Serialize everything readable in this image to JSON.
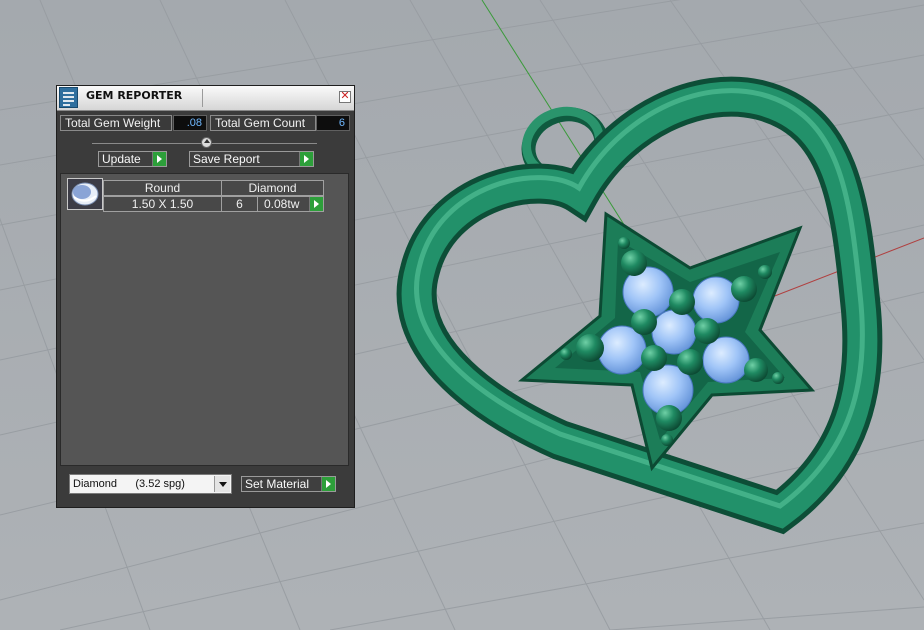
{
  "panel": {
    "title": "GEM REPORTER",
    "close_glyph": "✕",
    "app_icon": "gem-report-icon",
    "total_weight_label": "Total Gem Weight",
    "total_weight_value": ".08",
    "total_count_label": "Total Gem Count",
    "total_count_value": "6",
    "update_label": "Update",
    "save_report_label": "Save Report",
    "gem_list": {
      "columns": [
        "Round",
        "Diamond"
      ],
      "rows": [
        {
          "size": "1.50 X 1.50",
          "count": "6",
          "weight": "0.08tw",
          "thumb_icon": "round-gem-icon"
        }
      ]
    },
    "material_select_value": "Diamond      (3.52 spg)",
    "set_material_label": "Set Material"
  },
  "viewport": {
    "model": "heart-star-pendant",
    "background_color": "#a7acb1",
    "metal_color": "#1f7f5c",
    "gem_color": "#8fbcf4"
  }
}
